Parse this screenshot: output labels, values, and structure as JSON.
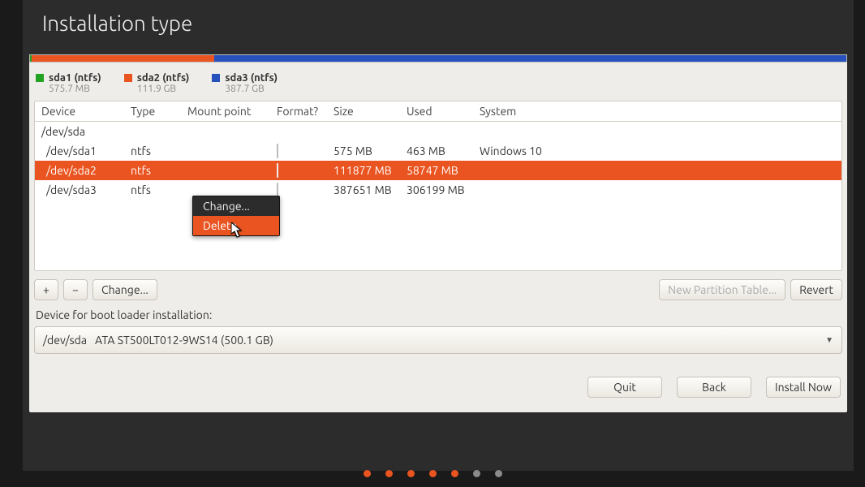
{
  "title": "Installation type",
  "legend": [
    {
      "name": "sda1 (ntfs)",
      "size": "575.7 MB",
      "color": "s-green"
    },
    {
      "name": "sda2 (ntfs)",
      "size": "111.9 GB",
      "color": "s-orange"
    },
    {
      "name": "sda3 (ntfs)",
      "size": "387.7 GB",
      "color": "s-blue"
    }
  ],
  "columns": {
    "device": "Device",
    "type": "Type",
    "mount": "Mount point",
    "format": "Format?",
    "size": "Size",
    "used": "Used",
    "system": "System"
  },
  "parent": "/dev/sda",
  "rows": [
    {
      "device": "/dev/sda1",
      "type": "ntfs",
      "size": "575 MB",
      "used": "463 MB",
      "system": "Windows 10",
      "selected": false
    },
    {
      "device": "/dev/sda2",
      "type": "ntfs",
      "size": "111877 MB",
      "used": "58747 MB",
      "system": "",
      "selected": true
    },
    {
      "device": "/dev/sda3",
      "type": "ntfs",
      "size": "387651 MB",
      "used": "306199 MB",
      "system": "",
      "selected": false
    }
  ],
  "buttons": {
    "add": "+",
    "remove": "−",
    "change": "Change...",
    "new_table": "New Partition Table...",
    "revert": "Revert"
  },
  "bootloader_label": "Device for boot loader installation:",
  "bootloader": {
    "device": "/dev/sda",
    "desc": "ATA ST500LT012-9WS14 (500.1 GB)"
  },
  "footer": {
    "quit": "Quit",
    "back": "Back",
    "install": "Install Now"
  },
  "context_menu": {
    "change": "Change...",
    "delete": "Delete"
  },
  "pager": {
    "total": 7,
    "active_color_count": 5
  }
}
